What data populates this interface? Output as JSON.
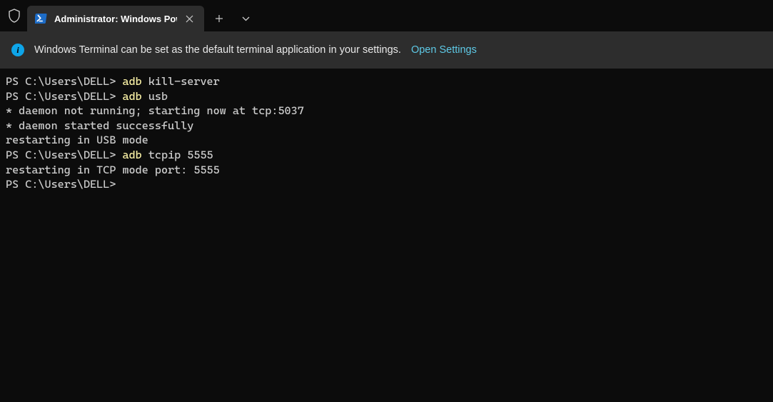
{
  "tab": {
    "title": "Administrator: Windows Pow",
    "icon_name": "powershell-icon"
  },
  "infobar": {
    "message": "Windows Terminal can be set as the default terminal application in your settings.",
    "link_label": "Open Settings"
  },
  "terminal": {
    "prompt": "PS C:\\Users\\DELL>",
    "lines": [
      {
        "type": "cmd",
        "prompt": "PS C:\\Users\\DELL>",
        "cmd": "adb",
        "args": " kill-server"
      },
      {
        "type": "cmd",
        "prompt": "PS C:\\Users\\DELL>",
        "cmd": "adb",
        "args": " usb"
      },
      {
        "type": "out",
        "text": "* daemon not running; starting now at tcp:5037"
      },
      {
        "type": "out",
        "text": "* daemon started successfully"
      },
      {
        "type": "out",
        "text": "restarting in USB mode"
      },
      {
        "type": "cmd",
        "prompt": "PS C:\\Users\\DELL>",
        "cmd": "adb",
        "args": " tcpip 5555"
      },
      {
        "type": "out",
        "text": "restarting in TCP mode port: 5555"
      },
      {
        "type": "cmd",
        "prompt": "PS C:\\Users\\DELL>",
        "cmd": "",
        "args": ""
      }
    ]
  }
}
